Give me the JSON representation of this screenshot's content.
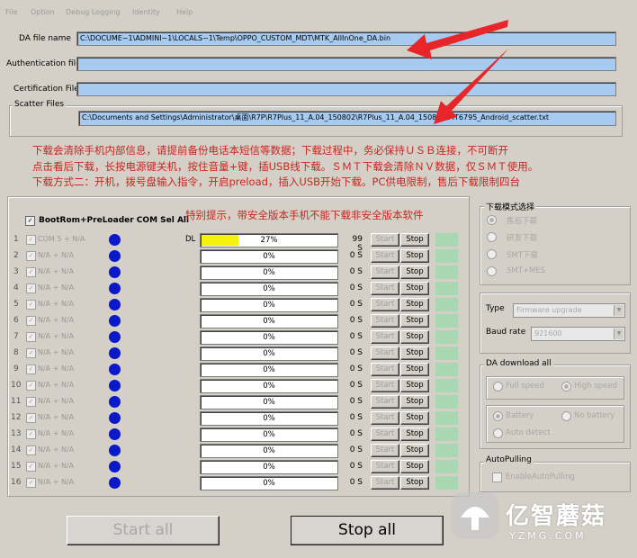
{
  "menu": [
    "File",
    "Option",
    "Debug Logging",
    "Identity",
    "Help"
  ],
  "fields": {
    "da_label": "DA file name",
    "da_value": "C:\\DOCUME~1\\ADMINI~1\\LOCALS~1\\Temp\\OPPO_CUSTOM_MDT\\MTK_AllInOne_DA.bin",
    "auth_label": "Authentication file",
    "auth_value": "",
    "cert_label": "Certification File",
    "cert_value": "",
    "scatter_label": "Scatter Files",
    "scatter_value": "C:\\Documents and Settings\\Administrator\\桌面\\R7P\\R7Plus_11_A.04_150802\\R7Plus_11_A.04_150802\\MT6795_Android_scatter.txt"
  },
  "notice": {
    "line1": "下载会清除手机内部信息，请提前备份电话本短信等数据；下载过程中，务必保持ＵＳＢ连接，不可断开",
    "line2": "点击看后下载，长按电源键关机，按住音量+键，插USB线下载。ＳＭＴ下载会清除ＮＶ数据，仅ＳＭＴ使用。",
    "line3": "下载方式二：开机，拨号盘输入指令，开启preload，插入USB开始下载。PC供电限制，售后下载限制四台"
  },
  "table_header": {
    "select_all_label": "BootRom+PreLoader COM Sel All",
    "warning": "特别提示，带安全版本手机不能下载非安全版本软件"
  },
  "rows": [
    {
      "no": "1",
      "port": "COM 5 + N/A",
      "stage": "DL",
      "percent": "27%",
      "progress": 0.27,
      "time": "99 S"
    },
    {
      "no": "2",
      "port": "N/A + N/A",
      "stage": "",
      "percent": "0%",
      "progress": 0,
      "time": "0 S"
    },
    {
      "no": "3",
      "port": "N/A + N/A",
      "stage": "",
      "percent": "0%",
      "progress": 0,
      "time": "0 S"
    },
    {
      "no": "4",
      "port": "N/A + N/A",
      "stage": "",
      "percent": "0%",
      "progress": 0,
      "time": "0 S"
    },
    {
      "no": "5",
      "port": "N/A + N/A",
      "stage": "",
      "percent": "0%",
      "progress": 0,
      "time": "0 S"
    },
    {
      "no": "6",
      "port": "N/A + N/A",
      "stage": "",
      "percent": "0%",
      "progress": 0,
      "time": "0 S"
    },
    {
      "no": "7",
      "port": "N/A + N/A",
      "stage": "",
      "percent": "0%",
      "progress": 0,
      "time": "0 S"
    },
    {
      "no": "8",
      "port": "N/A + N/A",
      "stage": "",
      "percent": "0%",
      "progress": 0,
      "time": "0 S"
    },
    {
      "no": "9",
      "port": "N/A + N/A",
      "stage": "",
      "percent": "0%",
      "progress": 0,
      "time": "0 S"
    },
    {
      "no": "10",
      "port": "N/A + N/A",
      "stage": "",
      "percent": "0%",
      "progress": 0,
      "time": "0 S"
    },
    {
      "no": "11",
      "port": "N/A + N/A",
      "stage": "",
      "percent": "0%",
      "progress": 0,
      "time": "0 S"
    },
    {
      "no": "12",
      "port": "N/A + N/A",
      "stage": "",
      "percent": "0%",
      "progress": 0,
      "time": "0 S"
    },
    {
      "no": "13",
      "port": "N/A + N/A",
      "stage": "",
      "percent": "0%",
      "progress": 0,
      "time": "0 S"
    },
    {
      "no": "14",
      "port": "N/A + N/A",
      "stage": "",
      "percent": "0%",
      "progress": 0,
      "time": "0 S"
    },
    {
      "no": "15",
      "port": "N/A + N/A",
      "stage": "",
      "percent": "0%",
      "progress": 0,
      "time": "0 S"
    },
    {
      "no": "16",
      "port": "N/A + N/A",
      "stage": "",
      "percent": "0%",
      "progress": 0,
      "time": "0 S"
    }
  ],
  "row_buttons": {
    "start": "Start",
    "stop": "Stop"
  },
  "download_mode": {
    "title": "下载模式选择",
    "options": [
      "售后下载",
      "研发下载",
      "SMT下载",
      "SMT+MES"
    ]
  },
  "type_group": {
    "type_label": "Type",
    "type_value": "Firmware upgrade",
    "baud_label": "Baud rate",
    "baud_value": "921600"
  },
  "da_download": {
    "title": "DA download all",
    "speed_options": [
      "Full speed",
      "High speed"
    ],
    "power_options": [
      "Battery",
      "No battery",
      "Auto detect"
    ]
  },
  "autopulling": {
    "title": "AutoPulling",
    "checkbox_label": "EnableAutoPulling"
  },
  "bottom": {
    "start_all": "Start all",
    "stop_all": "Stop all"
  },
  "watermark": {
    "text": "亿智蘑菇",
    "domain": "YZMG.COM"
  },
  "colors": {
    "field_blue": "#a6caf0",
    "status_green": "#a9d7b2",
    "dot_blue": "#0a18c8",
    "progress_yellow": "#f2f20a",
    "notice_red": "#c8261f",
    "arrow_red": "#e8262a"
  },
  "icons": [
    "arrow-annotation-icon",
    "status-dot-icon",
    "mushroom-logo-icon"
  ]
}
